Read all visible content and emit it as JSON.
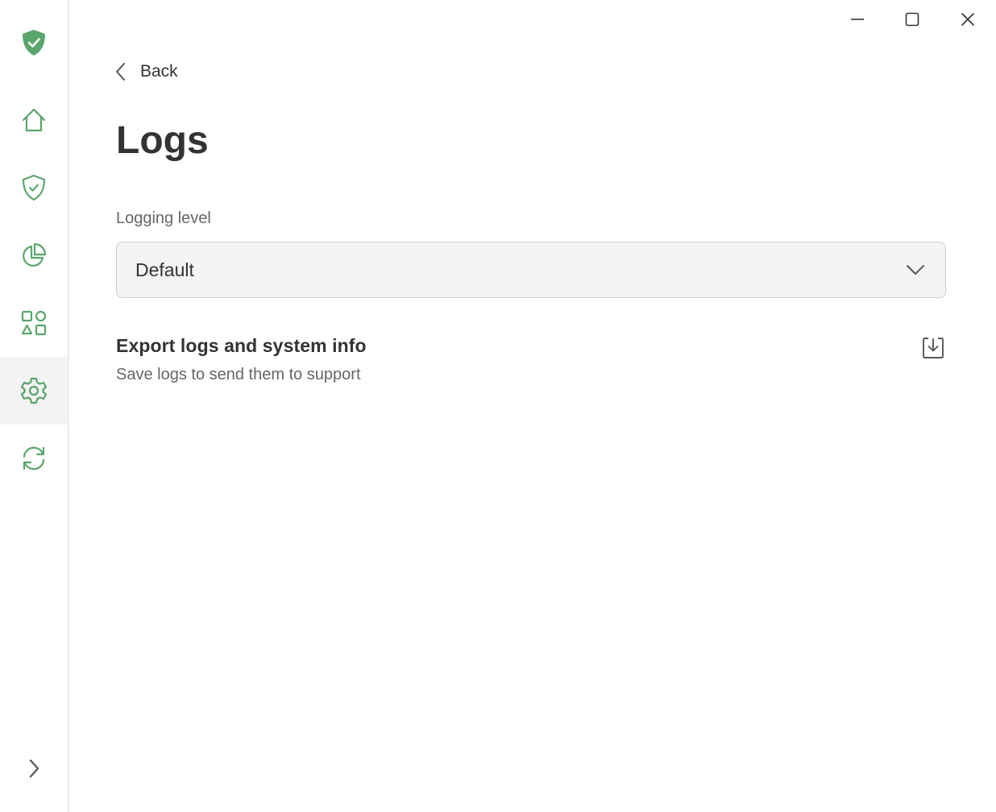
{
  "colors": {
    "accent": "#5aa56c",
    "text": "#333333",
    "muted": "#666666",
    "sidebar_active": "#f3f3f3",
    "select_bg": "#f4f4f4"
  },
  "sidebar": {
    "items": [
      {
        "name": "logo",
        "icon": "shield-check-filled-icon"
      },
      {
        "name": "home",
        "icon": "home-icon"
      },
      {
        "name": "protection",
        "icon": "shield-check-icon"
      },
      {
        "name": "statistics",
        "icon": "pie-chart-icon"
      },
      {
        "name": "apps",
        "icon": "apps-icon"
      },
      {
        "name": "settings",
        "icon": "gear-icon",
        "active": true
      },
      {
        "name": "update",
        "icon": "sync-icon"
      },
      {
        "name": "expand",
        "icon": "chevron-right-icon"
      }
    ]
  },
  "window_controls": [
    "minimize-icon",
    "maximize-icon",
    "close-icon"
  ],
  "header": {
    "back_label": "Back",
    "title": "Logs"
  },
  "logging": {
    "label": "Logging level",
    "selected": "Default"
  },
  "export": {
    "title": "Export logs and system info",
    "description": "Save logs to send them to support",
    "icon": "download-icon"
  }
}
